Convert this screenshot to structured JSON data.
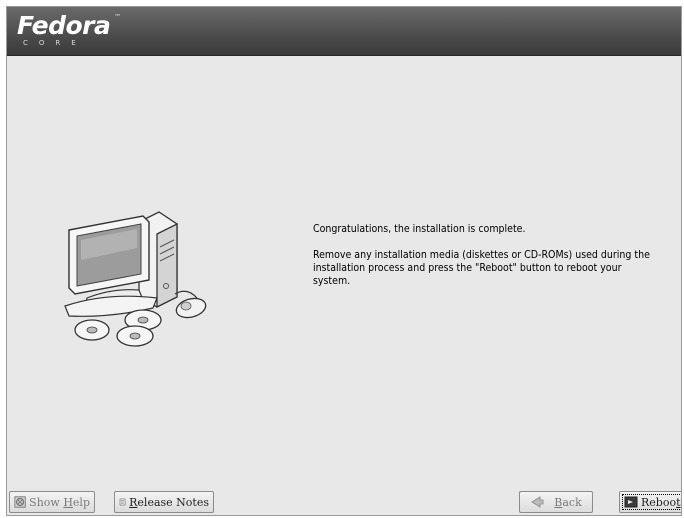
{
  "branding": {
    "logo_word": "Fedora",
    "logo_tm": "™",
    "logo_sub": "CORE"
  },
  "main": {
    "message_line_1": "Congratulations, the installation is complete.",
    "message_line_2": "Remove any installation media (diskettes or CD-ROMs) used during the installation process and press the \"Reboot\" button to reboot your system."
  },
  "buttons": {
    "show_help": {
      "prefix": "Show ",
      "mnemonic": "H",
      "rest": "elp",
      "enabled": false
    },
    "release_notes": {
      "prefix": "",
      "mnemonic": "R",
      "rest": "elease Notes",
      "enabled": true
    },
    "back": {
      "prefix": "",
      "mnemonic": "B",
      "rest": "ack",
      "enabled": false
    },
    "reboot": {
      "prefix": "Reboo",
      "mnemonic": "t",
      "rest": "",
      "enabled": true,
      "focused": true
    }
  },
  "icons": {
    "help": "help-icon",
    "notes": "release-notes-icon",
    "back": "back-arrow-icon",
    "reboot": "reboot-icon",
    "computer": "computer-with-discs-icon"
  }
}
